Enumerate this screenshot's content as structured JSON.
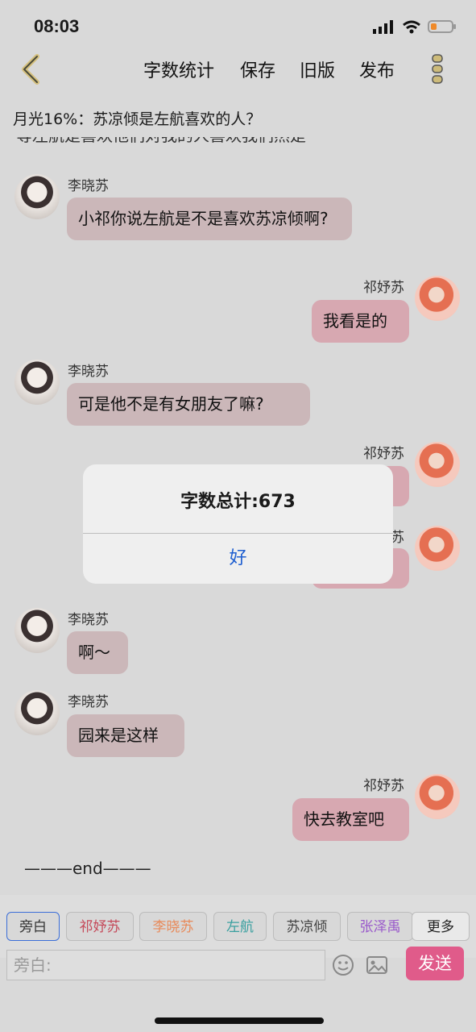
{
  "status_bar": {
    "time": "08:03"
  },
  "nav": {
    "items": [
      "字数统计",
      "保存",
      "旧版",
      "发布"
    ]
  },
  "notice": "月光16%：苏凉倾是左航喜欢的人？",
  "chat": {
    "partial_top_text": "等左航是喜欢他们对我的人喜欢我们然是",
    "messages": [
      {
        "side": "left",
        "name": "李晓苏",
        "text": "小祁你说左航是不是喜欢苏凉倾啊?"
      },
      {
        "side": "right",
        "name": "祁妤苏",
        "text": "我看是的"
      },
      {
        "side": "left",
        "name": "李晓苏",
        "text": "可是他不是有女朋友了嘛?"
      },
      {
        "side": "right",
        "name": "祁妤苏",
        "text": ""
      },
      {
        "side": "right",
        "name": "祁妤苏",
        "text": ""
      },
      {
        "side": "left",
        "name": "李晓苏",
        "text": "啊～"
      },
      {
        "side": "left",
        "name": "李晓苏",
        "text": "园来是这样"
      },
      {
        "side": "right",
        "name": "祁妤苏",
        "text": "快去教室吧"
      }
    ],
    "end_text": "———end———"
  },
  "dialog": {
    "title": "字数总计:673",
    "ok_label": "好"
  },
  "roles": [
    {
      "label": "旁白",
      "color": "#333333"
    },
    {
      "label": "祁妤苏",
      "color": "#c54a5a"
    },
    {
      "label": "李晓苏",
      "color": "#e88a5a"
    },
    {
      "label": "左航",
      "color": "#3aa0a0"
    },
    {
      "label": "苏凉倾",
      "color": "#444444"
    },
    {
      "label": "张泽禹",
      "color": "#9a5acb"
    },
    {
      "label": "更多",
      "color": "#222222"
    }
  ],
  "input": {
    "placeholder": "旁白:"
  },
  "send_label": "发送"
}
